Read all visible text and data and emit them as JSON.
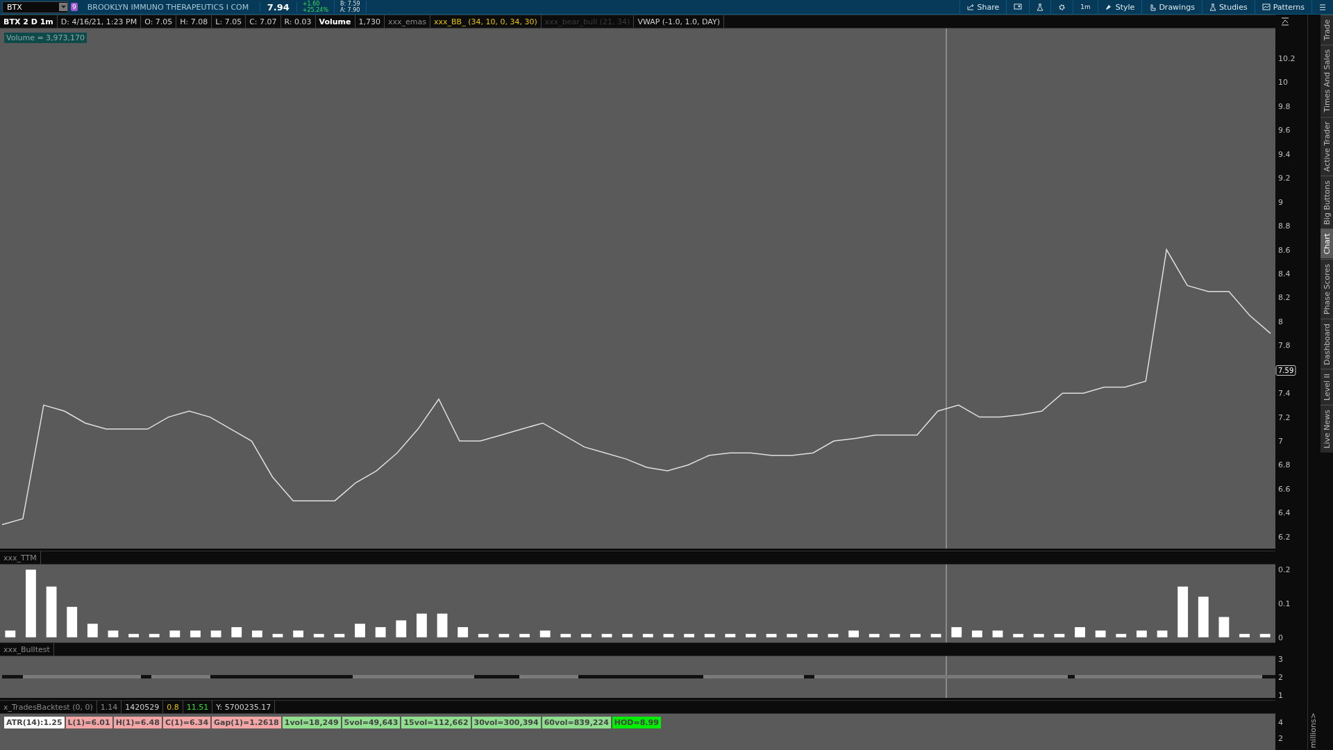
{
  "top_bar": {
    "symbol": "BTX",
    "badge": "9",
    "company": "BROOKLYN IMMUNO THERAPEUTICS I COM",
    "last": "7.94",
    "change": "+1.60",
    "change_pct": "+25.24%",
    "bid": "B: 7.59",
    "ask": "A: 7.90",
    "buttons": [
      {
        "kind": "share",
        "label": "Share"
      },
      {
        "kind": "screen"
      },
      {
        "kind": "flask"
      },
      {
        "kind": "gear"
      },
      {
        "kind": "text",
        "label": "1m"
      },
      {
        "kind": "style",
        "label": "Style"
      },
      {
        "kind": "hand",
        "label": "Drawings"
      },
      {
        "kind": "flask",
        "label": "Studies"
      },
      {
        "kind": "pattern",
        "label": "Patterns"
      },
      {
        "kind": "list"
      }
    ]
  },
  "study_header": [
    {
      "text": "BTX 2 D 1m",
      "kind": "symbol"
    },
    {
      "text": "D: 4/16/21, 1:23 PM",
      "kind": "value"
    },
    {
      "text": "O: 7.05",
      "kind": "value"
    },
    {
      "text": "H: 7.08",
      "kind": "value"
    },
    {
      "text": "L: 7.05",
      "kind": "value"
    },
    {
      "text": "C: 7.07",
      "kind": "value"
    },
    {
      "text": "R: 0.03",
      "kind": "value"
    },
    {
      "text": "Volume",
      "kind": "symbol"
    },
    {
      "text": "1,730",
      "kind": "value"
    },
    {
      "text": "xxx_emas",
      "kind": "muted"
    },
    {
      "text": "xxx_BB_ (34, 10, 0, 34, 30)",
      "kind": "warn"
    },
    {
      "text": "xxx_bear_bull (21, 34)",
      "kind": "hidden"
    },
    {
      "text": "VWAP (-1.0, 1.0, DAY)",
      "kind": "value"
    }
  ],
  "price_chart": {
    "volume_label": "Volume = 3,973,170",
    "price_tag": "7.59",
    "chart_data": {
      "type": "line",
      "ylim": [
        6.1,
        10.45
      ],
      "yticks": [
        6.2,
        6.4,
        6.6,
        6.8,
        7,
        7.2,
        7.4,
        7.8,
        8,
        8.2,
        8.4,
        8.6,
        8.8,
        9,
        9.2,
        9.4,
        9.6,
        9.8,
        10,
        10.2
      ],
      "series": [
        {
          "color": "#e0e0e0",
          "values": [
            6.3,
            6.35,
            7.3,
            7.25,
            7.15,
            7.1,
            7.1,
            7.1,
            7.2,
            7.25,
            7.2,
            7.1,
            7.0,
            6.7,
            6.5,
            6.5,
            6.5,
            6.65,
            6.75,
            6.9,
            7.1,
            7.35,
            7.0,
            7.0,
            7.05,
            7.1,
            7.15,
            7.05,
            6.95,
            6.9,
            6.85,
            6.78,
            6.75,
            6.8,
            6.88,
            6.9,
            6.9,
            6.88,
            6.88,
            6.9,
            7.0,
            7.02,
            7.05,
            7.05,
            7.05,
            7.25,
            7.3,
            7.2,
            7.2,
            7.22,
            7.25,
            7.4,
            7.4,
            7.45,
            7.45,
            7.5,
            8.6,
            8.3,
            8.25,
            8.25,
            8.05,
            7.9
          ]
        }
      ]
    }
  },
  "ttm": {
    "title": "xxx_TTM",
    "chart_data": {
      "type": "bar",
      "ylim": [
        -0.015,
        0.215
      ],
      "yticks": [
        0,
        0.1,
        0.2
      ],
      "series": [
        {
          "color": "#ffffff",
          "values": [
            0.02,
            0.2,
            0.15,
            0.09,
            0.04,
            0.02,
            0.01,
            0.01,
            0.02,
            0.02,
            0.02,
            0.03,
            0.02,
            0.01,
            0.02,
            0.01,
            0.01,
            0.04,
            0.03,
            0.05,
            0.07,
            0.07,
            0.03,
            0.01,
            0.01,
            0.01,
            0.02,
            0.01,
            0.01,
            0.01,
            0.01,
            0.01,
            0.01,
            0.01,
            0.01,
            0.01,
            0.01,
            0.01,
            0.01,
            0.01,
            0.01,
            0.02,
            0.01,
            0.01,
            0.01,
            0.01,
            0.03,
            0.02,
            0.02,
            0.01,
            0.01,
            0.01,
            0.03,
            0.02,
            0.01,
            0.02,
            0.02,
            0.15,
            0.12,
            0.06,
            0.01,
            0.01
          ]
        }
      ]
    }
  },
  "bulltest": {
    "title": "xxx_Bulltest",
    "axis_labels": [
      "3",
      "2",
      "1"
    ]
  },
  "backtest": {
    "items": [
      {
        "text": "x_TradesBacktest (0, 0)",
        "kind": "muted"
      },
      {
        "text": "1.14",
        "kind": "muted"
      },
      {
        "text": "1420529",
        "kind": "value"
      },
      {
        "text": "0.8",
        "kind": "warn"
      },
      {
        "text": "11.51",
        "kind": "good"
      },
      {
        "text": "Y: 5700235.17",
        "kind": "value"
      }
    ],
    "chips": [
      {
        "text": "ATR(14):1.25",
        "color": "#ffffff"
      },
      {
        "text": "L(1)=6.01",
        "color": "#f4a6a6"
      },
      {
        "text": "H(1)=6.48",
        "color": "#f4a6a6"
      },
      {
        "text": "C(1)=6.34",
        "color": "#f4a6a6"
      },
      {
        "text": "Gap(1)=1.2618",
        "color": "#f4a6a6"
      },
      {
        "text": "1vol=18,249",
        "color": "#8fdf8f"
      },
      {
        "text": "5vol=49,643",
        "color": "#8fdf8f"
      },
      {
        "text": "15vol=112,662",
        "color": "#8fdf8f"
      },
      {
        "text": "30vol=300,394",
        "color": "#8fdf8f"
      },
      {
        "text": "60vol=839,224",
        "color": "#8fdf8f"
      },
      {
        "text": "HOD=8.99",
        "color": "#00ee00"
      }
    ],
    "axis_labels": [
      "4",
      "2"
    ],
    "unit": "millions>"
  },
  "side_tabs": [
    {
      "label": "Trade",
      "selected": false
    },
    {
      "label": "Times And Sales",
      "selected": false
    },
    {
      "label": "Active Trader",
      "selected": false
    },
    {
      "label": "Big Buttons",
      "selected": false
    },
    {
      "label": "Chart",
      "selected": true
    },
    {
      "label": "Phase Scores",
      "selected": false
    },
    {
      "label": "Dashboard",
      "selected": false
    },
    {
      "label": "Level II",
      "selected": false
    },
    {
      "label": "Live News",
      "selected": false
    }
  ]
}
